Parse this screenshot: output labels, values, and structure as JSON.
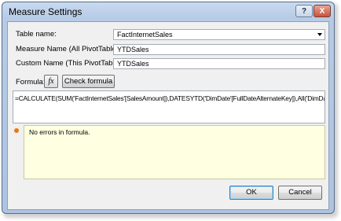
{
  "window": {
    "title": "Measure Settings",
    "help_label": "?",
    "close_label": "X"
  },
  "form": {
    "table_name_label": "Table name:",
    "table_name_value": "FactInternetSales",
    "measure_name_all_label": "Measure Name (All PivotTables):",
    "measure_name_all_value": "YTDSales",
    "custom_name_label": "Custom Name (This PivotTable):",
    "custom_name_value": "YTDSales",
    "formula_label": "Formula:",
    "fx_label": "fx",
    "check_formula_label": "Check formula",
    "formula_text": "=CALCULATE(SUM('FactInternetSales'[SalesAmount]),DATESYTD('DimDate'[FullDateAlternateKey]),All('DimDate'))",
    "status_text": "No errors in formula.",
    "status_color": "#e9780f"
  },
  "footer": {
    "ok_label": "OK",
    "cancel_label": "Cancel"
  }
}
